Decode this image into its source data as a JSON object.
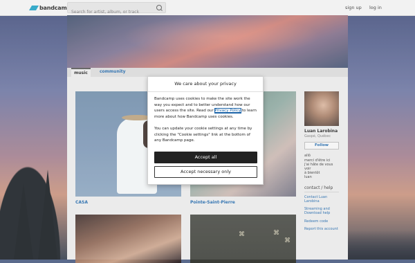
{
  "header": {
    "logo_text": "bandcamp",
    "search_placeholder": "Search for artist, album, or track",
    "signup": "sign up",
    "login": "log in"
  },
  "tabs": [
    "music",
    "community"
  ],
  "albums": [
    {
      "title": "CASA"
    },
    {
      "title": "Pointe-Saint-Pierre"
    },
    {
      "title": ""
    },
    {
      "title": ""
    }
  ],
  "artist": {
    "name": "Luan Larobina",
    "location": "Gaspé, Québec",
    "follow": "Follow",
    "bio_lines": [
      "allô",
      "merci d'être ici",
      "j'ai hâte de vous",
      "voir",
      "à bientôt",
      "luan"
    ]
  },
  "contact": {
    "heading": "contact / help",
    "links": [
      "Contact Luan Larobina",
      "Streaming and Download help",
      "Redeem code",
      "Report this account"
    ]
  },
  "cookie_modal": {
    "title": "We care about your privacy",
    "text1_before": "Bandcamp uses cookies to make the site work the way you expect and to better understand how our users access the site. Read our ",
    "privacy_link": "Privacy Policy",
    "text1_after": " to learn more about how Bandcamp uses cookies.",
    "text2": "You can update your cookie settings at any time by clicking the \"Cookie settings\" link at the bottom of any Bandcamp page.",
    "accept_all": "Accept all",
    "accept_necessary": "Accept necessary only"
  },
  "colors": {
    "link_blue": "#1a63a8",
    "logo_accent": "#1da0c3",
    "dark_button": "#222222"
  }
}
